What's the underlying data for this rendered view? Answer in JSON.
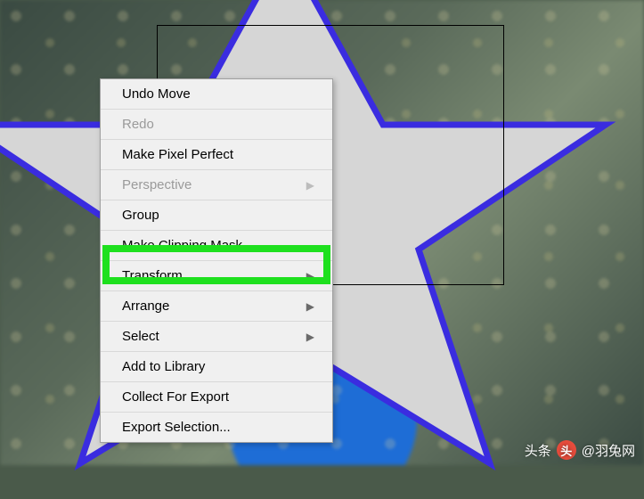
{
  "menu": {
    "items": [
      {
        "label": "Undo Move",
        "disabled": false,
        "submenu": false
      },
      {
        "label": "Redo",
        "disabled": true,
        "submenu": false
      },
      {
        "label": "Make Pixel Perfect",
        "disabled": false,
        "submenu": false
      },
      {
        "label": "Perspective",
        "disabled": true,
        "submenu": true
      },
      {
        "label": "Group",
        "disabled": false,
        "submenu": false
      },
      {
        "label": "Make Clipping Mask",
        "disabled": false,
        "submenu": false,
        "highlighted": true
      },
      {
        "label": "Transform",
        "disabled": false,
        "submenu": true
      },
      {
        "label": "Arrange",
        "disabled": false,
        "submenu": true
      },
      {
        "label": "Select",
        "disabled": false,
        "submenu": true
      },
      {
        "label": "Add to Library",
        "disabled": false,
        "submenu": false
      },
      {
        "label": "Collect For Export",
        "disabled": false,
        "submenu": false
      },
      {
        "label": "Export Selection...",
        "disabled": false,
        "submenu": false
      }
    ]
  },
  "canvas": {
    "star_stroke": "#3a2ce0",
    "star_fill": "#d6d6d6"
  },
  "watermark": {
    "prefix": "头条",
    "badge": "头",
    "handle": "@羽兔网"
  }
}
